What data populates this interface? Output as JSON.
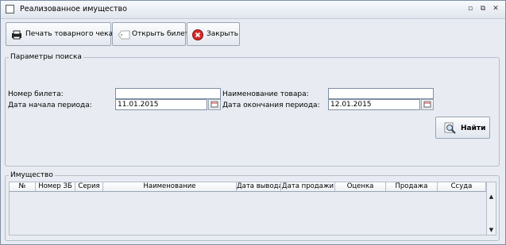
{
  "window": {
    "title": "Реализованное имущество",
    "controls": [
      "minimize-icon",
      "maximize-icon",
      "close-icon"
    ]
  },
  "toolbar": {
    "print_label": "Печать товарного чека",
    "open_label": "Открыть билет",
    "close_label": "Закрыть"
  },
  "search": {
    "legend": "Параметры поиска",
    "ticket_label": "Номер билета:",
    "ticket_value": "",
    "product_label": "Наименование товара:",
    "product_value": "",
    "start_label": "Дата начала периода:",
    "start_value": "11.01.2015",
    "end_label": "Дата окончания периода:",
    "end_value": "12.01.2015",
    "find_label": "Найти"
  },
  "property": {
    "legend": "Имущество",
    "columns": [
      "№",
      "Номер ЗБ",
      "Серия",
      "Наименование",
      "Дата вывода",
      "Дата продажи",
      "Оценка",
      "Продажа",
      "Ссуда"
    ],
    "rows": []
  },
  "colors": {
    "window_bg": "#e8ecf2",
    "titlebar": "#e1e6ee",
    "border": "#7f8ea3"
  }
}
